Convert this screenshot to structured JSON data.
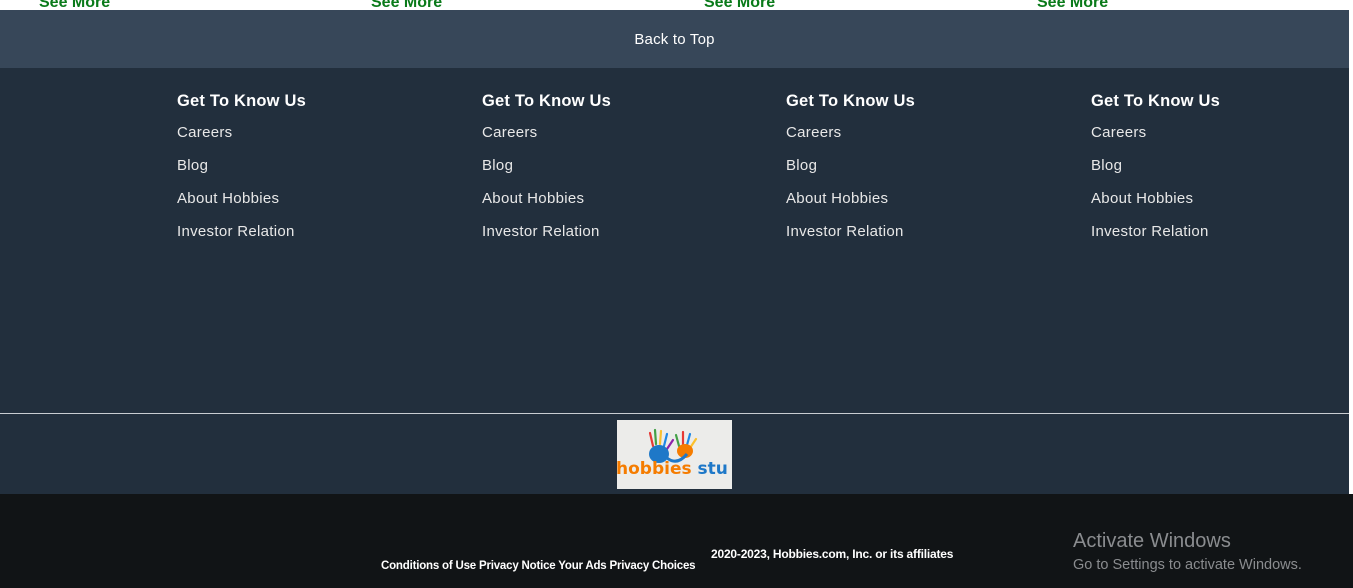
{
  "see_more": [
    "See More",
    "See More",
    "See More",
    "See More"
  ],
  "back_to_top": "Back to Top",
  "footer_columns": [
    {
      "heading": "Get To Know Us",
      "links": [
        "Careers",
        "Blog",
        "About Hobbies",
        "Investor Relation"
      ]
    },
    {
      "heading": "Get To Know Us",
      "links": [
        "Careers",
        "Blog",
        "About Hobbies",
        "Investor Relation"
      ]
    },
    {
      "heading": "Get To Know Us",
      "links": [
        "Careers",
        "Blog",
        "About Hobbies",
        "Investor Relation"
      ]
    },
    {
      "heading": "Get To Know Us",
      "links": [
        "Careers",
        "Blog",
        "About Hobbies",
        "Investor Relation"
      ]
    }
  ],
  "logo": {
    "text": "hobbies stu"
  },
  "copyright": "2020-2023, Hobbies.com, Inc. or its affiliates",
  "legal_links": [
    "Conditions of Use",
    "Privacy Notice",
    "Your Ads Privacy Choices"
  ],
  "watermark": {
    "title": "Activate Windows",
    "subtitle": "Go to Settings to activate Windows."
  },
  "colors": {
    "back_to_top_bg": "#374759",
    "footer_bg": "#222f3d",
    "bottom_bg": "#111416",
    "see_more": "#0a7a1a"
  }
}
